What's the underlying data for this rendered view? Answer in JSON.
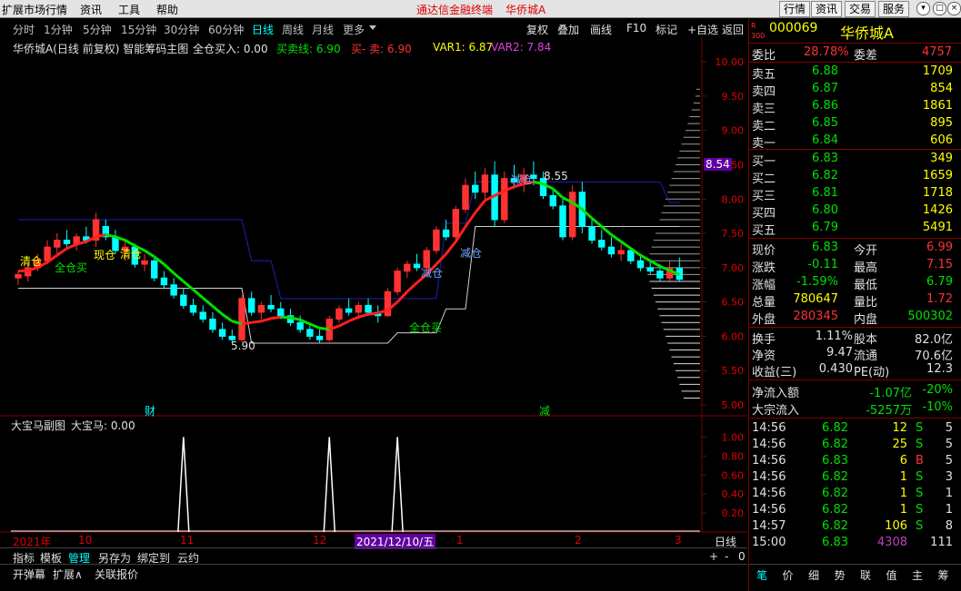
{
  "menubar": {
    "items": [
      "扩展市场行情",
      "资讯",
      "工具",
      "帮助"
    ],
    "center_left": "通达信金融终端",
    "center_right": "华侨城A",
    "right_buttons": [
      "行情",
      "资讯",
      "交易",
      "服务"
    ]
  },
  "periods": [
    "分时",
    "1分钟",
    "5分钟",
    "15分钟",
    "30分钟",
    "60分钟",
    "日线",
    "周线",
    "月线",
    "更多"
  ],
  "active_period": "日线",
  "tools": [
    "复权",
    "叠加",
    "画线",
    "F10",
    "标记",
    "+自选",
    "返回"
  ],
  "main_legend": {
    "title": "华侨城A(日线 前复权) 智能筹码主图",
    "full_buy": "全仓买入: 0.00",
    "mm_line": "买卖线: 6.90",
    "buy_sell": "买- 卖: 6.90",
    "var1": "VAR1: 6.87",
    "var2": "VAR2: 7.84"
  },
  "annotations": {
    "high": "8.55",
    "low": "5.90",
    "price_tag": "8.54",
    "clear1": "清仓",
    "clear2": "清仓",
    "full_buy1": "全仓买",
    "full_buy2": "全仓买",
    "reduce1": "减仓",
    "reduce2": "减仓",
    "reduce3": "减仓",
    "now": "现仓",
    "cai": "财",
    "jian": "减"
  },
  "y_axis": [
    "10.00",
    "9.50",
    "9.00",
    "8.50",
    "8.00",
    "7.50",
    "7.00",
    "6.50",
    "6.00",
    "5.50",
    "5.00"
  ],
  "sub_legend": {
    "title": "大宝马副图",
    "value": "大宝马: 0.00"
  },
  "sub_axis": [
    "1.00",
    "0.80",
    "0.60",
    "0.40",
    "0.20"
  ],
  "date_axis": {
    "year": "2021年",
    "m10": "10",
    "m11": "11",
    "m12": "12",
    "highlight": "2021/12/10/五",
    "m1": "1",
    "m2": "2",
    "m3": "3",
    "period": "日线"
  },
  "bottom_tabs": [
    "指标",
    "模板",
    "管理",
    "另存为",
    "绑定到",
    "云约"
  ],
  "bottom_tabs2": [
    "开弹幕",
    "扩展∧",
    "关联报价"
  ],
  "bottom_right": [
    "+",
    "-",
    "0"
  ],
  "quote": {
    "code": "000069",
    "name": "华侨城A",
    "badge": "R\n300",
    "wb": "28.78%",
    "wc": "4757",
    "sell": [
      [
        "卖五",
        "6.88",
        "1709"
      ],
      [
        "卖四",
        "6.87",
        "854"
      ],
      [
        "卖三",
        "6.86",
        "1861"
      ],
      [
        "卖二",
        "6.85",
        "895"
      ],
      [
        "卖一",
        "6.84",
        "606"
      ]
    ],
    "buy": [
      [
        "买一",
        "6.83",
        "349"
      ],
      [
        "买二",
        "6.82",
        "1659"
      ],
      [
        "买三",
        "6.81",
        "1718"
      ],
      [
        "买四",
        "6.80",
        "1426"
      ],
      [
        "买五",
        "6.79",
        "5491"
      ]
    ],
    "stats": [
      [
        "现价",
        "6.83",
        "今开",
        "6.99"
      ],
      [
        "涨跌",
        "-0.11",
        "最高",
        "7.15"
      ],
      [
        "涨幅",
        "-1.59%",
        "最低",
        "6.79"
      ],
      [
        "总量",
        "780647",
        "量比",
        "1.72"
      ],
      [
        "外盘",
        "280345",
        "内盘",
        "500302"
      ]
    ],
    "fin": [
      [
        "换手",
        "1.11%",
        "股本",
        "82.0亿"
      ],
      [
        "净资",
        "9.47",
        "流通",
        "70.6亿"
      ],
      [
        "收益(三)",
        "0.430",
        "PE(动)",
        "12.3"
      ]
    ],
    "flow": [
      [
        "净流入额",
        "-1.07亿",
        "-20%"
      ],
      [
        "大宗流入",
        "-5257万",
        "-10%"
      ]
    ],
    "ticks": [
      [
        "14:56",
        "6.82",
        "12",
        "S",
        "5"
      ],
      [
        "14:56",
        "6.82",
        "25",
        "S",
        "5"
      ],
      [
        "14:56",
        "6.83",
        "6",
        "B",
        "5"
      ],
      [
        "14:56",
        "6.82",
        "1",
        "S",
        "3"
      ],
      [
        "14:56",
        "6.82",
        "1",
        "S",
        "1"
      ],
      [
        "14:56",
        "6.82",
        "1",
        "S",
        "1"
      ],
      [
        "14:57",
        "6.82",
        "106",
        "S",
        "8"
      ],
      [
        "15:00",
        "6.83",
        "4308",
        "",
        "111"
      ]
    ],
    "tabs": [
      "笔",
      "价",
      "细",
      "势",
      "联",
      "值",
      "主",
      "筹"
    ]
  },
  "labels": {
    "wb": "委比",
    "wc": "委差"
  },
  "colors": {
    "up": "#ff3232",
    "down": "#00ffff",
    "green": "#00e000",
    "yellow": "#ffff00",
    "navy": "#2020b0",
    "purple": "#c040c0"
  },
  "chart_data": {
    "type": "candlestick",
    "ylim": [
      5.0,
      10.2
    ],
    "candles": [
      [
        6.85,
        6.95,
        6.75,
        6.9
      ],
      [
        6.88,
        7.05,
        6.8,
        7.0
      ],
      [
        7.0,
        7.2,
        6.95,
        7.1
      ],
      [
        7.1,
        7.4,
        7.05,
        7.3
      ],
      [
        7.3,
        7.5,
        7.2,
        7.4
      ],
      [
        7.4,
        7.55,
        7.3,
        7.35
      ],
      [
        7.35,
        7.5,
        7.25,
        7.45
      ],
      [
        7.45,
        7.6,
        7.35,
        7.4
      ],
      [
        7.4,
        7.8,
        7.3,
        7.7
      ],
      [
        7.6,
        7.7,
        7.4,
        7.45
      ],
      [
        7.45,
        7.55,
        7.2,
        7.25
      ],
      [
        7.25,
        7.4,
        7.1,
        7.3
      ],
      [
        7.3,
        7.35,
        7.0,
        7.05
      ],
      [
        7.05,
        7.2,
        6.95,
        7.1
      ],
      [
        7.1,
        7.15,
        6.8,
        6.85
      ],
      [
        6.85,
        6.95,
        6.7,
        6.75
      ],
      [
        6.75,
        6.85,
        6.55,
        6.6
      ],
      [
        6.6,
        6.7,
        6.4,
        6.45
      ],
      [
        6.45,
        6.55,
        6.3,
        6.35
      ],
      [
        6.35,
        6.45,
        6.2,
        6.25
      ],
      [
        6.25,
        6.35,
        6.05,
        6.1
      ],
      [
        6.1,
        6.2,
        5.95,
        6.0
      ],
      [
        6.0,
        6.1,
        5.9,
        5.95
      ],
      [
        5.95,
        6.6,
        5.92,
        6.55
      ],
      [
        6.55,
        6.65,
        6.3,
        6.35
      ],
      [
        6.35,
        6.5,
        6.25,
        6.45
      ],
      [
        6.45,
        6.6,
        6.35,
        6.4
      ],
      [
        6.4,
        6.5,
        6.25,
        6.3
      ],
      [
        6.3,
        6.4,
        6.15,
        6.2
      ],
      [
        6.2,
        6.3,
        6.05,
        6.1
      ],
      [
        6.1,
        6.2,
        5.95,
        6.0
      ],
      [
        6.0,
        6.1,
        5.9,
        5.95
      ],
      [
        5.95,
        6.3,
        5.92,
        6.25
      ],
      [
        6.25,
        6.45,
        6.2,
        6.4
      ],
      [
        6.4,
        6.55,
        6.3,
        6.35
      ],
      [
        6.35,
        6.5,
        6.25,
        6.45
      ],
      [
        6.45,
        6.55,
        6.3,
        6.35
      ],
      [
        6.35,
        6.45,
        6.2,
        6.3
      ],
      [
        6.3,
        6.7,
        6.28,
        6.65
      ],
      [
        6.65,
        7.0,
        6.6,
        6.95
      ],
      [
        6.95,
        7.1,
        6.85,
        7.05
      ],
      [
        7.05,
        7.2,
        6.95,
        7.0
      ],
      [
        7.0,
        7.3,
        6.95,
        7.25
      ],
      [
        7.25,
        7.6,
        7.2,
        7.55
      ],
      [
        7.55,
        7.7,
        7.4,
        7.45
      ],
      [
        7.45,
        7.9,
        7.4,
        7.85
      ],
      [
        7.85,
        8.3,
        7.8,
        8.2
      ],
      [
        8.2,
        8.4,
        8.0,
        8.1
      ],
      [
        8.1,
        8.45,
        8.0,
        8.35
      ],
      [
        8.35,
        8.55,
        7.6,
        7.7
      ],
      [
        7.7,
        8.4,
        7.65,
        8.3
      ],
      [
        8.3,
        8.5,
        8.15,
        8.25
      ],
      [
        8.25,
        8.45,
        8.1,
        8.35
      ],
      [
        8.35,
        8.55,
        8.2,
        8.3
      ],
      [
        8.3,
        8.4,
        8.0,
        8.05
      ],
      [
        8.05,
        8.15,
        7.85,
        7.9
      ],
      [
        7.9,
        8.0,
        7.4,
        7.45
      ],
      [
        7.45,
        8.2,
        7.4,
        8.1
      ],
      [
        8.1,
        8.25,
        7.5,
        7.6
      ],
      [
        7.6,
        7.7,
        7.35,
        7.4
      ],
      [
        7.4,
        7.55,
        7.25,
        7.3
      ],
      [
        7.3,
        7.45,
        7.15,
        7.2
      ],
      [
        7.2,
        7.35,
        7.1,
        7.25
      ],
      [
        7.25,
        7.3,
        7.05,
        7.1
      ],
      [
        7.1,
        7.2,
        6.95,
        7.0
      ],
      [
        7.0,
        7.1,
        6.9,
        6.95
      ],
      [
        6.95,
        7.05,
        6.8,
        6.85
      ],
      [
        6.85,
        7.1,
        6.8,
        6.99
      ],
      [
        6.99,
        7.15,
        6.79,
        6.83
      ]
    ],
    "ma": [
      6.95,
      6.96,
      7.0,
      7.08,
      7.18,
      7.28,
      7.34,
      7.38,
      7.45,
      7.48,
      7.45,
      7.4,
      7.32,
      7.25,
      7.16,
      7.05,
      6.92,
      6.8,
      6.68,
      6.56,
      6.44,
      6.32,
      6.22,
      6.18,
      6.2,
      6.22,
      6.26,
      6.28,
      6.27,
      6.24,
      6.18,
      6.12,
      6.1,
      6.15,
      6.22,
      6.28,
      6.32,
      6.34,
      6.38,
      6.5,
      6.65,
      6.78,
      6.9,
      7.05,
      7.2,
      7.38,
      7.6,
      7.8,
      7.98,
      8.05,
      8.12,
      8.18,
      8.22,
      8.25,
      8.22,
      8.15,
      8.02,
      7.95,
      7.85,
      7.72,
      7.6,
      7.48,
      7.38,
      7.28,
      7.18,
      7.1,
      7.02,
      6.96,
      6.9
    ],
    "upper": [
      7.7,
      7.7,
      7.7,
      7.7,
      7.7,
      7.7,
      7.7,
      7.7,
      7.7,
      7.7,
      7.7,
      7.7,
      7.7,
      7.7,
      7.7,
      7.7,
      7.7,
      7.7,
      7.7,
      7.7,
      7.7,
      7.7,
      7.7,
      7.7,
      7.1,
      7.1,
      7.1,
      6.55,
      6.55,
      6.55,
      6.55,
      6.55,
      6.55,
      6.55,
      6.55,
      6.55,
      6.55,
      6.55,
      6.55,
      6.55,
      6.55,
      6.55,
      6.55,
      6.55,
      7.65,
      7.65,
      7.65,
      8.25,
      8.25,
      8.25,
      8.25,
      8.25,
      8.25,
      8.25,
      8.25,
      8.25,
      8.25,
      8.25,
      8.25,
      8.25,
      8.25,
      8.25,
      8.25,
      8.25,
      8.25,
      8.25,
      8.25,
      7.95,
      7.95
    ],
    "lower": [
      6.7,
      6.7,
      6.7,
      6.7,
      6.7,
      6.7,
      6.7,
      6.7,
      6.7,
      6.7,
      6.7,
      6.7,
      6.7,
      6.7,
      6.7,
      6.7,
      6.7,
      6.7,
      6.7,
      6.7,
      6.7,
      6.7,
      6.7,
      6.7,
      5.9,
      5.9,
      5.9,
      5.9,
      5.9,
      5.9,
      5.9,
      5.9,
      5.9,
      5.9,
      5.9,
      5.9,
      5.9,
      5.9,
      5.9,
      6.05,
      6.05,
      6.05,
      6.05,
      6.05,
      6.4,
      6.4,
      6.4,
      7.6,
      7.6,
      7.6,
      7.6,
      7.6,
      7.6,
      7.6,
      7.6,
      7.6,
      7.6,
      7.6,
      7.6,
      7.6,
      7.6,
      7.6,
      7.6,
      7.6,
      7.6,
      7.6,
      7.6,
      7.6,
      7.6
    ],
    "sub_spikes": [
      [
        17,
        1.0
      ],
      [
        32,
        1.0
      ],
      [
        39,
        1.0
      ]
    ],
    "sub_ylim": [
      0,
      1.1
    ]
  }
}
